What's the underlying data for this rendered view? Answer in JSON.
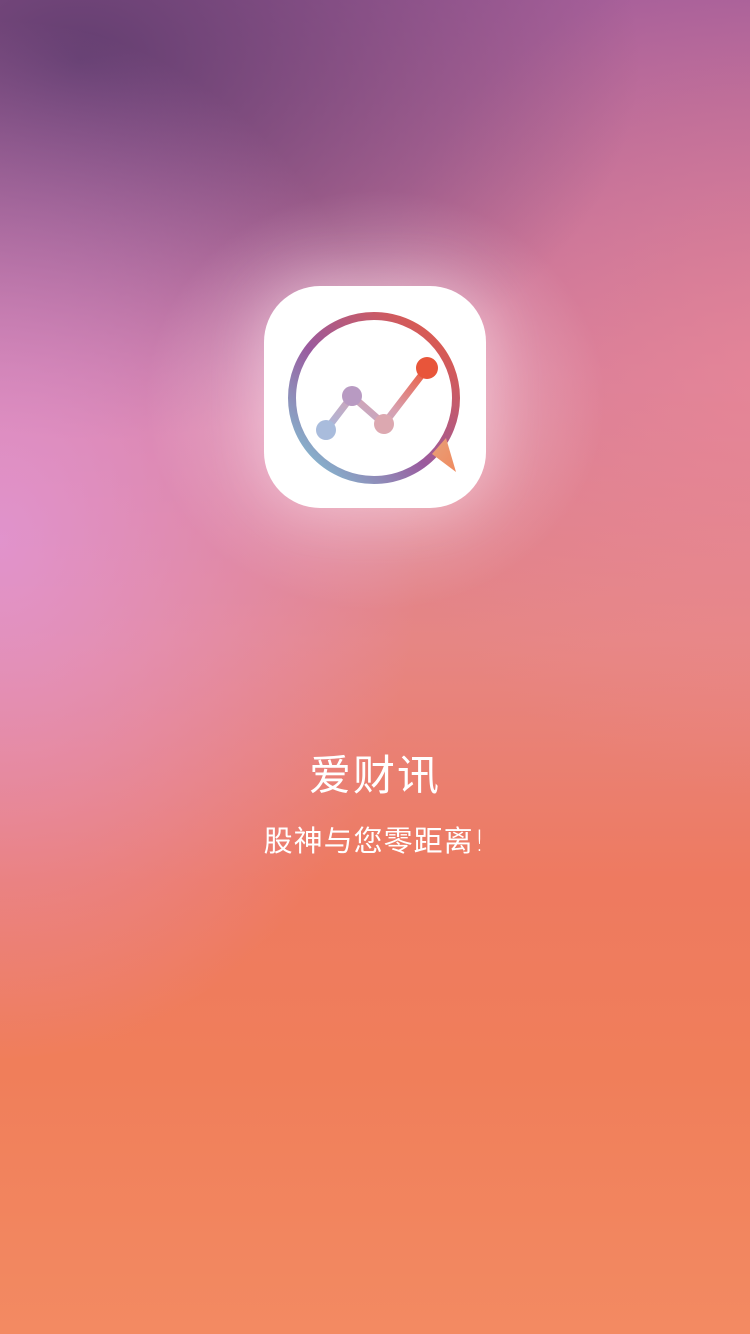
{
  "splash": {
    "app_name": "爱财讯",
    "tagline": "股神与您零距离!"
  },
  "logo": {
    "icon": "trend-chat-bubble-icon",
    "colors": {
      "tile": "#ffffff",
      "ring_start": "#7fd0dc",
      "ring_mid": "#9a5a9e",
      "ring_end": "#ec5a3c",
      "tail": "#f29a6a"
    }
  },
  "theme": {
    "gradient_top": "#5f3c6e",
    "gradient_mid": "#e68684",
    "gradient_bottom": "#f38a62"
  }
}
